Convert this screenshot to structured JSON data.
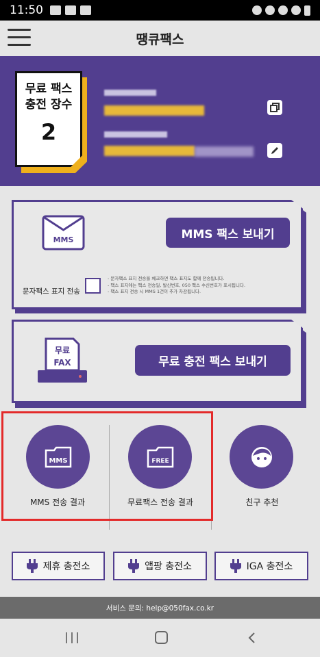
{
  "status_bar": {
    "time": "11:50"
  },
  "app": {
    "title": "땡큐팩스"
  },
  "credit_card": {
    "line1": "무료 팩스",
    "line2": "충전 장수",
    "count": "2"
  },
  "mms_panel": {
    "button_label": "MMS 팩스 보내기",
    "icon_text": "MMS",
    "checkbox_label": "문자팩스 표지 전송",
    "notes": [
      "- 문자팩스 표지 전송을 체크하면 팩스 표지도 함께 전송됩니다.",
      "- 팩스 표지에는 팩스 전송일, 발신번호, 050 팩스 수신번호가 표시됩니다.",
      "- 팩스 표지 전송 시 MMS 1건이 추가 차감됩니다."
    ]
  },
  "free_panel": {
    "button_label": "무료 충전 팩스 보내기",
    "icon_line1": "무료",
    "icon_line2": "FAX"
  },
  "shortcuts": [
    {
      "label": "MMS 전송 결과",
      "icon_text": "MMS"
    },
    {
      "label": "무료팩스 전송 결과",
      "icon_text": "FREE"
    },
    {
      "label": "친구 추천"
    }
  ],
  "charge_stations": [
    {
      "label": "제휴 충전소"
    },
    {
      "label": "앱팡 충전소"
    },
    {
      "label": "IGA 충전소"
    }
  ],
  "footer": {
    "text": "서비스 문의: help@050fax.co.kr"
  },
  "colors": {
    "primary": "#523e8f",
    "accent": "#efb01c",
    "highlight": "#e32a2a"
  }
}
